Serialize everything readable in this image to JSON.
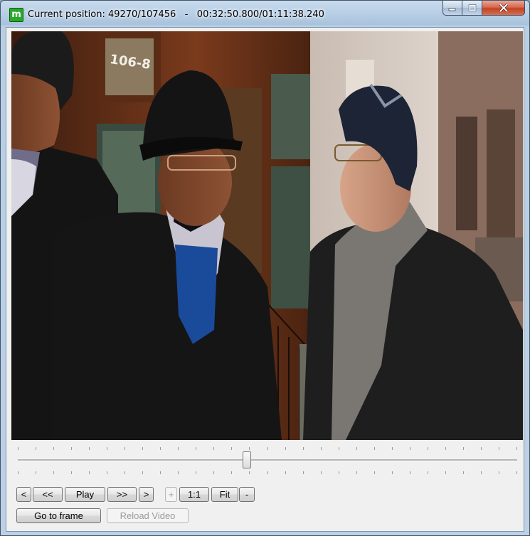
{
  "window": {
    "title": "Current position: 49270/107456   -   00:32:50.800/01:11:38.240",
    "app_icon_glyph": "m"
  },
  "caption_buttons": {
    "minimize_icon": "minimize-icon",
    "maximize_icon": "maximize-icon",
    "close_icon": "close-icon"
  },
  "video": {
    "current_frame": 49270,
    "total_frames": 107456,
    "current_time": "00:32:50.800",
    "total_time": "01:11:38.240",
    "building_sign": "106-8"
  },
  "seek_slider": {
    "position_fraction": 0.4585
  },
  "controls": {
    "prev_frame": "<",
    "rewind": "<<",
    "play": "Play",
    "fast_forward": ">>",
    "next_frame": ">",
    "zoom_in": "+",
    "actual_size": "1:1",
    "fit": "Fit",
    "zoom_out": "-",
    "go_to_frame": "Go to frame",
    "reload_video": "Reload Video"
  },
  "colors": {
    "title_bar": "#a9c3dd",
    "close_button": "#c4421f",
    "app_icon": "#2aa82a",
    "client_background": "#f0f0f0"
  }
}
